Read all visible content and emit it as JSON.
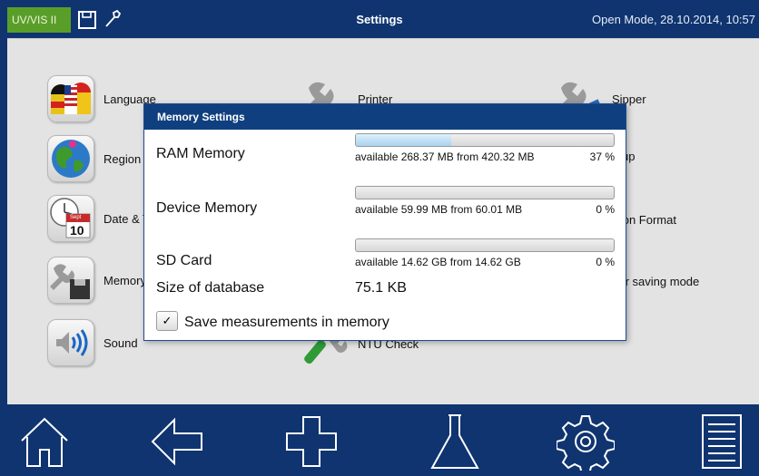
{
  "topbar": {
    "mode": "UV/VIS II",
    "title": "Settings",
    "status": "Open Mode, 28.10.2014, 10:57",
    "colors": {
      "background": "#0f3470",
      "mode_tag": "#5a9e2a"
    }
  },
  "settings_items": [
    {
      "name": "language",
      "label": "Language",
      "icon": "flags-icon"
    },
    {
      "name": "region",
      "label": "Region",
      "icon": "globe-icon"
    },
    {
      "name": "date-time",
      "label": "Date & T",
      "icon": "calendar-clock-icon",
      "calendar_month": "Sept",
      "calendar_day": "10"
    },
    {
      "name": "memory",
      "label": "Memory",
      "icon": "wrench-disk-icon"
    },
    {
      "name": "sound",
      "label": "Sound",
      "icon": "speaker-icon"
    },
    {
      "name": "printer",
      "label": "Printer",
      "icon": "wrench-icon"
    },
    {
      "name": "ntu-check",
      "label": "NTU Check",
      "icon": "tube-wrench-icon"
    },
    {
      "name": "sipper",
      "label": "Sipper",
      "icon": "wrench-icon"
    },
    {
      "name": "backup",
      "label": "ckup",
      "icon": "none"
    },
    {
      "name": "solution-format",
      "label": "ution Format",
      "icon": "none"
    },
    {
      "name": "power-saving",
      "label": "wer saving mode",
      "icon": "none"
    }
  ],
  "dialog": {
    "title": "Memory Settings",
    "ram": {
      "label": "RAM Memory",
      "info": "available 268.37 MB from 420.32 MB",
      "percent_text": "37 %",
      "fill_fraction": 0.37
    },
    "device": {
      "label": "Device Memory",
      "info": "available 59.99 MB from 60.01 MB",
      "percent_text": "0 %",
      "fill_fraction": 0.0
    },
    "sd": {
      "label": "SD Card",
      "info": "available 14.62 GB from 14.62 GB",
      "percent_text": "0 %",
      "fill_fraction": 0.0
    },
    "database": {
      "label": "Size of database",
      "value": "75.1 KB"
    },
    "save_measurements": {
      "label": "Save measurements in memory",
      "checked": true,
      "check_glyph": "✓"
    }
  },
  "bottom_nav": [
    {
      "name": "home",
      "icon": "home-icon"
    },
    {
      "name": "back",
      "icon": "back-arrow-icon"
    },
    {
      "name": "add",
      "icon": "plus-icon"
    },
    {
      "name": "flask",
      "icon": "flask-icon"
    },
    {
      "name": "settings",
      "icon": "gear-icon"
    },
    {
      "name": "menu",
      "icon": "list-icon"
    }
  ]
}
